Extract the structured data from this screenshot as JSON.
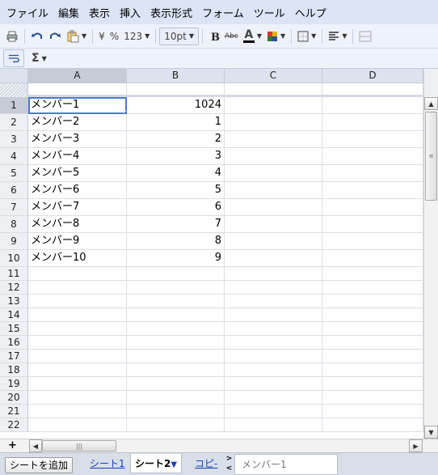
{
  "menu": [
    "ファイル",
    "編集",
    "表示",
    "挿入",
    "表示形式",
    "フォーム",
    "ツール",
    "ヘルプ"
  ],
  "toolbar": {
    "currency": "¥",
    "percent": "%",
    "number_format": "123",
    "font_size": "10pt",
    "strikethrough": "Abc",
    "text_color": "A",
    "sum": "Σ"
  },
  "columns": [
    "A",
    "B",
    "C",
    "D"
  ],
  "rows": [
    {
      "n": "1",
      "a": "メンバー1",
      "b": "1024"
    },
    {
      "n": "2",
      "a": "メンバー2",
      "b": "1"
    },
    {
      "n": "3",
      "a": "メンバー3",
      "b": "2"
    },
    {
      "n": "4",
      "a": "メンバー4",
      "b": "3"
    },
    {
      "n": "5",
      "a": "メンバー5",
      "b": "4"
    },
    {
      "n": "6",
      "a": "メンバー6",
      "b": "5"
    },
    {
      "n": "7",
      "a": "メンバー7",
      "b": "6"
    },
    {
      "n": "8",
      "a": "メンバー8",
      "b": "7"
    },
    {
      "n": "9",
      "a": "メンバー9",
      "b": "8"
    },
    {
      "n": "10",
      "a": "メンバー10",
      "b": "9"
    },
    {
      "n": "11",
      "a": "",
      "b": ""
    },
    {
      "n": "12",
      "a": "",
      "b": ""
    },
    {
      "n": "13",
      "a": "",
      "b": ""
    },
    {
      "n": "14",
      "a": "",
      "b": ""
    },
    {
      "n": "15",
      "a": "",
      "b": ""
    },
    {
      "n": "16",
      "a": "",
      "b": ""
    },
    {
      "n": "17",
      "a": "",
      "b": ""
    },
    {
      "n": "18",
      "a": "",
      "b": ""
    },
    {
      "n": "19",
      "a": "",
      "b": ""
    },
    {
      "n": "20",
      "a": "",
      "b": ""
    },
    {
      "n": "21",
      "a": "",
      "b": ""
    },
    {
      "n": "22",
      "a": "",
      "b": ""
    }
  ],
  "sheets": {
    "add_button": "シートを追加",
    "tab1": "シート1",
    "tab2": "シート2",
    "tab2_arrow": "▼",
    "tab3": "コピ-",
    "nav_next": ">",
    "nav_prev": "<"
  },
  "status_summary": "メンバー1",
  "colors": {
    "menubar": "#dbe5f6",
    "selection": "#4a7bd0",
    "link": "#1a3fbd"
  }
}
